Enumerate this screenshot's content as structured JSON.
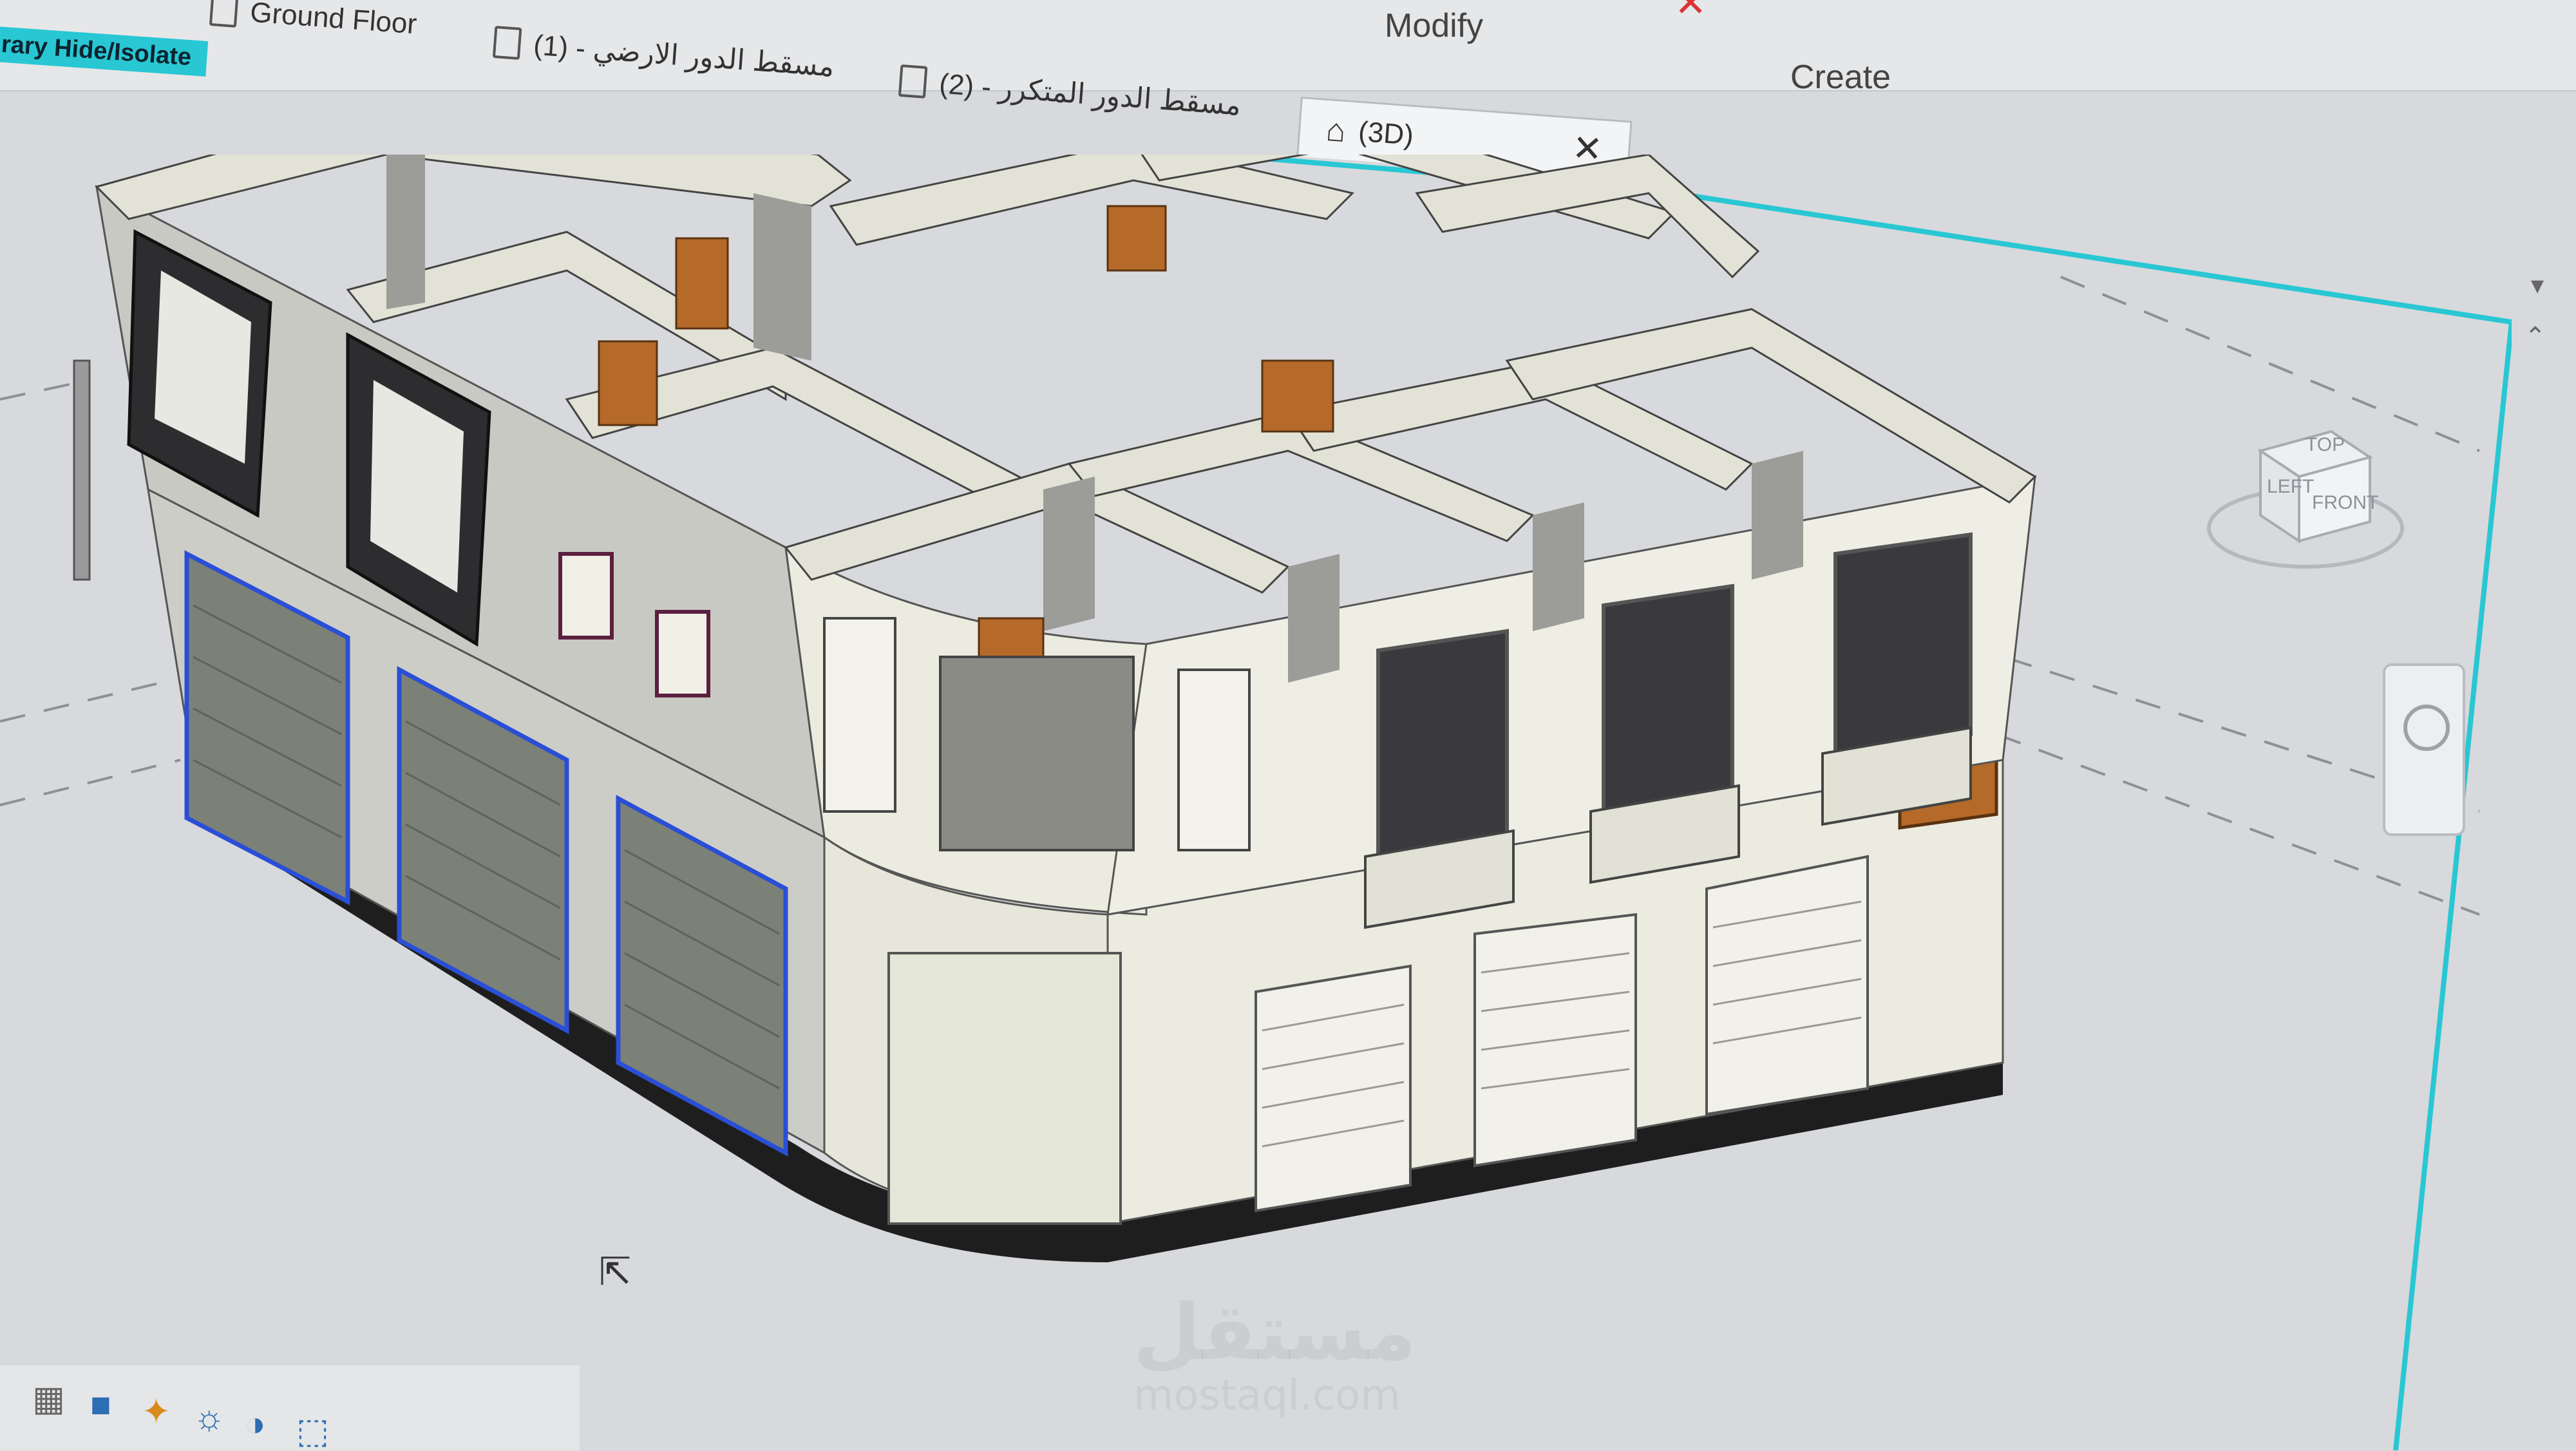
{
  "ribbon": {
    "modify_label": "Modify",
    "create_label": "Create"
  },
  "status": {
    "hide_isolate_label": "rary Hide/Isolate"
  },
  "tabs": [
    {
      "label": "Ground Floor"
    },
    {
      "label": "مسقط الدور الارضي - (1)"
    },
    {
      "label": "مسقط الدور المتكرر - (2)"
    },
    {
      "label": "(3D)"
    }
  ],
  "viewcube": {
    "face_left": "LEFT",
    "face_front": "FRONT",
    "face_top": "TOP"
  },
  "watermark": {
    "text": "مستقل",
    "subtext": "mostaql.com"
  },
  "colors": {
    "accent": "#28c7d3",
    "close": "#d33333",
    "selection_blue": "#2a4fd6",
    "wall_face": "#ecebe0",
    "wall_shadow": "#9c9c98",
    "base_dark": "#1e1e1e",
    "door_wood": "#b56a2a"
  },
  "icons": {
    "modify": "cursor-arrow-icon",
    "close": "close-icon",
    "tab_document": "document-icon",
    "tab_3d": "house-icon",
    "viewcube": "viewcube-icon",
    "nav_wheel": "steering-wheel-icon"
  }
}
